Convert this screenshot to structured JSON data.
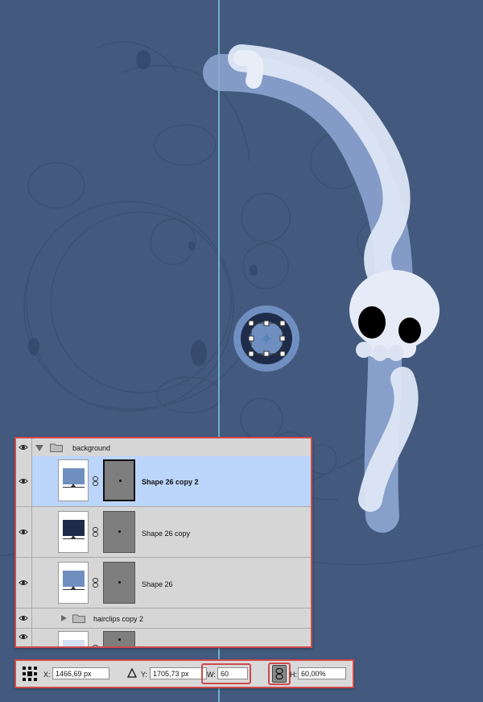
{
  "layers_panel": {
    "group_name": "background",
    "layers": [
      {
        "name": "Shape 26 copy 2",
        "swatch": "#6f8fc0",
        "selected": true
      },
      {
        "name": "Shape 26 copy",
        "swatch": "#1e2c4a",
        "selected": false
      },
      {
        "name": "Shape 26",
        "swatch": "#6f8fc0",
        "selected": false
      }
    ],
    "subgroup_name": "hairclips copy 2",
    "partial_layer_swatch": "#d4e0f4"
  },
  "options_bar": {
    "x_label": "X:",
    "x_value": "1466,69 px",
    "y_label": "Y:",
    "y_value": "1705,73 px",
    "w_label": "W:",
    "w_value": "60",
    "h_label": "H:",
    "h_value": "60,00%"
  },
  "colors": {
    "canvas_bg": "#435a7e",
    "guide": "#7fcce0",
    "ribbon_light": "#dde7f6",
    "ribbon_mid": "#8ea7d2",
    "circle_outer": "#6f8fc0",
    "circle_inner": "#1e2c4a",
    "highlight": "#d04a4a",
    "selected_row": "#bcd5fb"
  }
}
